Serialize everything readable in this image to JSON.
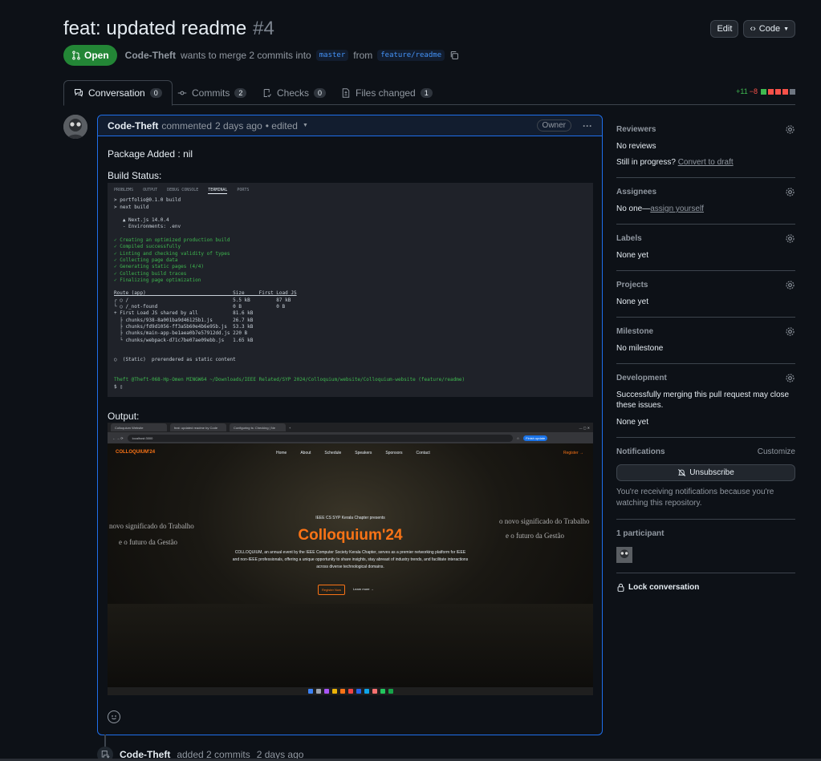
{
  "pr": {
    "title": "feat: updated readme",
    "number": "#4",
    "state": "Open",
    "author": "Code-Theft",
    "merge_text": "wants to merge 2 commits into",
    "base_branch": "master",
    "from_text": "from",
    "head_branch": "feature/readme"
  },
  "header_actions": {
    "edit": "Edit",
    "code": "Code"
  },
  "tabs": [
    {
      "label": "Conversation",
      "count": "0"
    },
    {
      "label": "Commits",
      "count": "2"
    },
    {
      "label": "Checks",
      "count": "0"
    },
    {
      "label": "Files changed",
      "count": "1"
    }
  ],
  "diffstat": {
    "additions": "+11",
    "deletions": "−8"
  },
  "comment": {
    "author": "Code-Theft",
    "action": "commented",
    "time": "2 days ago",
    "edited": "• edited",
    "role": "Owner",
    "package_line": "Package Added : nil",
    "build_label": "Build Status:",
    "output_label": "Output:"
  },
  "terminal": {
    "tabs": [
      "PROBLEMS",
      "OUTPUT",
      "DEBUG CONSOLE",
      "TERMINAL",
      "PORTS"
    ],
    "lines": [
      "> portfolio@0.1.0 build",
      "> next build",
      "",
      "   ▲ Next.js 14.0.4",
      "   - Environments: .env",
      "",
      "✓ Creating an optimized production build",
      "✓ Compiled successfully",
      "✓ Linting and checking validity of types",
      "✓ Collecting page data",
      "✓ Generating static pages (4/4)",
      "✓ Collecting build traces",
      "✓ Finalizing page optimization",
      "",
      "Route (app)                              Size     First Load JS",
      "┌ ○ /                                    5.5 kB         87 kB",
      "└ ○ /_not-found                          0 B            0 B",
      "+ First Load JS shared by all            81.6 kB",
      "  ├ chunks/938-8a001ba9d46125b1.js       26.7 kB",
      "  ├ chunks/fd9d1056-ff3a5b60e4b6e95b.js  53.3 kB",
      "  ├ chunks/main-app-be1aea0b7e57912dd.js 220 B",
      "  └ chunks/webpack-d71c7be07ae09ebb.js   1.65 kB",
      "",
      "",
      "○  (Static)  prerendered as static content",
      "",
      "",
      "Theft @Theft-068-Hp-Omen MINGW64 ~/Downloads/IEEE Related/SYP 2024/Colloquium/website/Colloquium-website (feature/readme)",
      "$ ▯"
    ]
  },
  "browser": {
    "tabs": [
      "Colloquium Website",
      "feat: updated readme by Code",
      "Configuring ts: Checking | Ne"
    ],
    "url": "localhost:3000",
    "update_btn": "Finish update"
  },
  "site": {
    "logo": "COLLOQUIUM'24",
    "nav": [
      "Home",
      "About",
      "Schedule",
      "Speakers",
      "Sponsors",
      "Contact"
    ],
    "register": "Register →",
    "kicker": "IEEE CS SYP Kerala Chapter presents",
    "title": "Colloquium'24",
    "description": "COLLOQUIUM, an annual event by the IEEE Computer Society Kerala Chapter, serves as a premier networking platform for IEEE and non-IEEE professionals, offering a unique opportunity to share insights, stay abreast of industry trends, and facilitate interactions across diverse technological domains.",
    "btn_register": "Register Now",
    "btn_learn": "Learn more →",
    "wall_left_1": "novo significado do Trabalho",
    "wall_left_2": "e o futuro da Gestão",
    "wall_right_1": "o novo significado do Trabalho",
    "wall_right_2": "e o futuro da Gestão"
  },
  "event": {
    "author": "Code-Theft",
    "text": "added 2 commits",
    "time": "2 days ago"
  },
  "sidebar": {
    "reviewers": {
      "title": "Reviewers",
      "value": "No reviews",
      "still": "Still in progress?",
      "convert": "Convert to draft"
    },
    "assignees": {
      "title": "Assignees",
      "value": "No one—",
      "link": "assign yourself"
    },
    "labels": {
      "title": "Labels",
      "value": "None yet"
    },
    "projects": {
      "title": "Projects",
      "value": "None yet"
    },
    "milestone": {
      "title": "Milestone",
      "value": "No milestone"
    },
    "development": {
      "title": "Development",
      "text": "Successfully merging this pull request may close these issues.",
      "value": "None yet"
    },
    "notifications": {
      "title": "Notifications",
      "customize": "Customize",
      "button": "Unsubscribe",
      "note": "You're receiving notifications because you're watching this repository."
    },
    "participants": {
      "title": "1 participant"
    },
    "lock": "Lock conversation"
  },
  "colors": {
    "open_green": "#238636",
    "accent_blue": "#1f6feb",
    "brand_orange": "#f97316"
  }
}
